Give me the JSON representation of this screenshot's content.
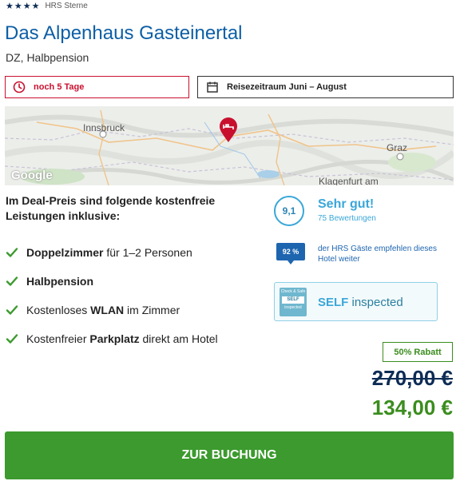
{
  "header": {
    "stars_glyph": "★★★★",
    "stars_label": "HRS Sterne",
    "title": "Das Alpenhaus Gasteinertal",
    "room_info": "DZ, Halbpension"
  },
  "chips": {
    "timer": {
      "label": "noch 5 Tage",
      "icon": "clock-icon",
      "color": "#c8102e"
    },
    "travel_period": {
      "label": "Reisezeitraum Juni – August",
      "icon": "calendar-icon"
    }
  },
  "map": {
    "labels": {
      "innsbruck": "Innsbruck",
      "graz": "Graz",
      "klagenfurt": "Klagenfurt am",
      "google": "Google"
    },
    "marker_icon": "hotel-bed-pin-icon"
  },
  "deal": {
    "heading": "Im Deal-Preis sind folgende kostenfreie Leistungen inklusive:",
    "features": [
      {
        "pre": "",
        "bold": "Doppelzimmer",
        "post": " für 1–2 Personen"
      },
      {
        "pre": "",
        "bold": "Halbpension",
        "post": ""
      },
      {
        "pre": "Kostenloses ",
        "bold": "WLAN",
        "post": " im Zimmer"
      },
      {
        "pre": "Kostenfreier ",
        "bold": "Parkplatz",
        "post": " direkt am Hotel"
      }
    ]
  },
  "rating": {
    "score": "9,1",
    "word": "Sehr gut!",
    "count": "75 Bewertungen",
    "recommend_percent": "92 %",
    "recommend_text": "der HRS Gäste empfehlen dieses Hotel weiter"
  },
  "self_inspected": {
    "logo_top": "Check & Safe",
    "logo_mid": "SELF",
    "logo_bottom": "inspected",
    "label_bold": "SELF",
    "label_rest": " inspected"
  },
  "price": {
    "discount": "50% Rabatt",
    "old": "270,00 €",
    "new": "134,00 €"
  },
  "cta": {
    "label": "ZUR BUCHUNG"
  },
  "colors": {
    "brand_blue": "#0d5fa6",
    "navy": "#0d2c55",
    "green": "#3c9a2e",
    "rating_blue": "#3aa7d8",
    "red": "#c8102e"
  }
}
